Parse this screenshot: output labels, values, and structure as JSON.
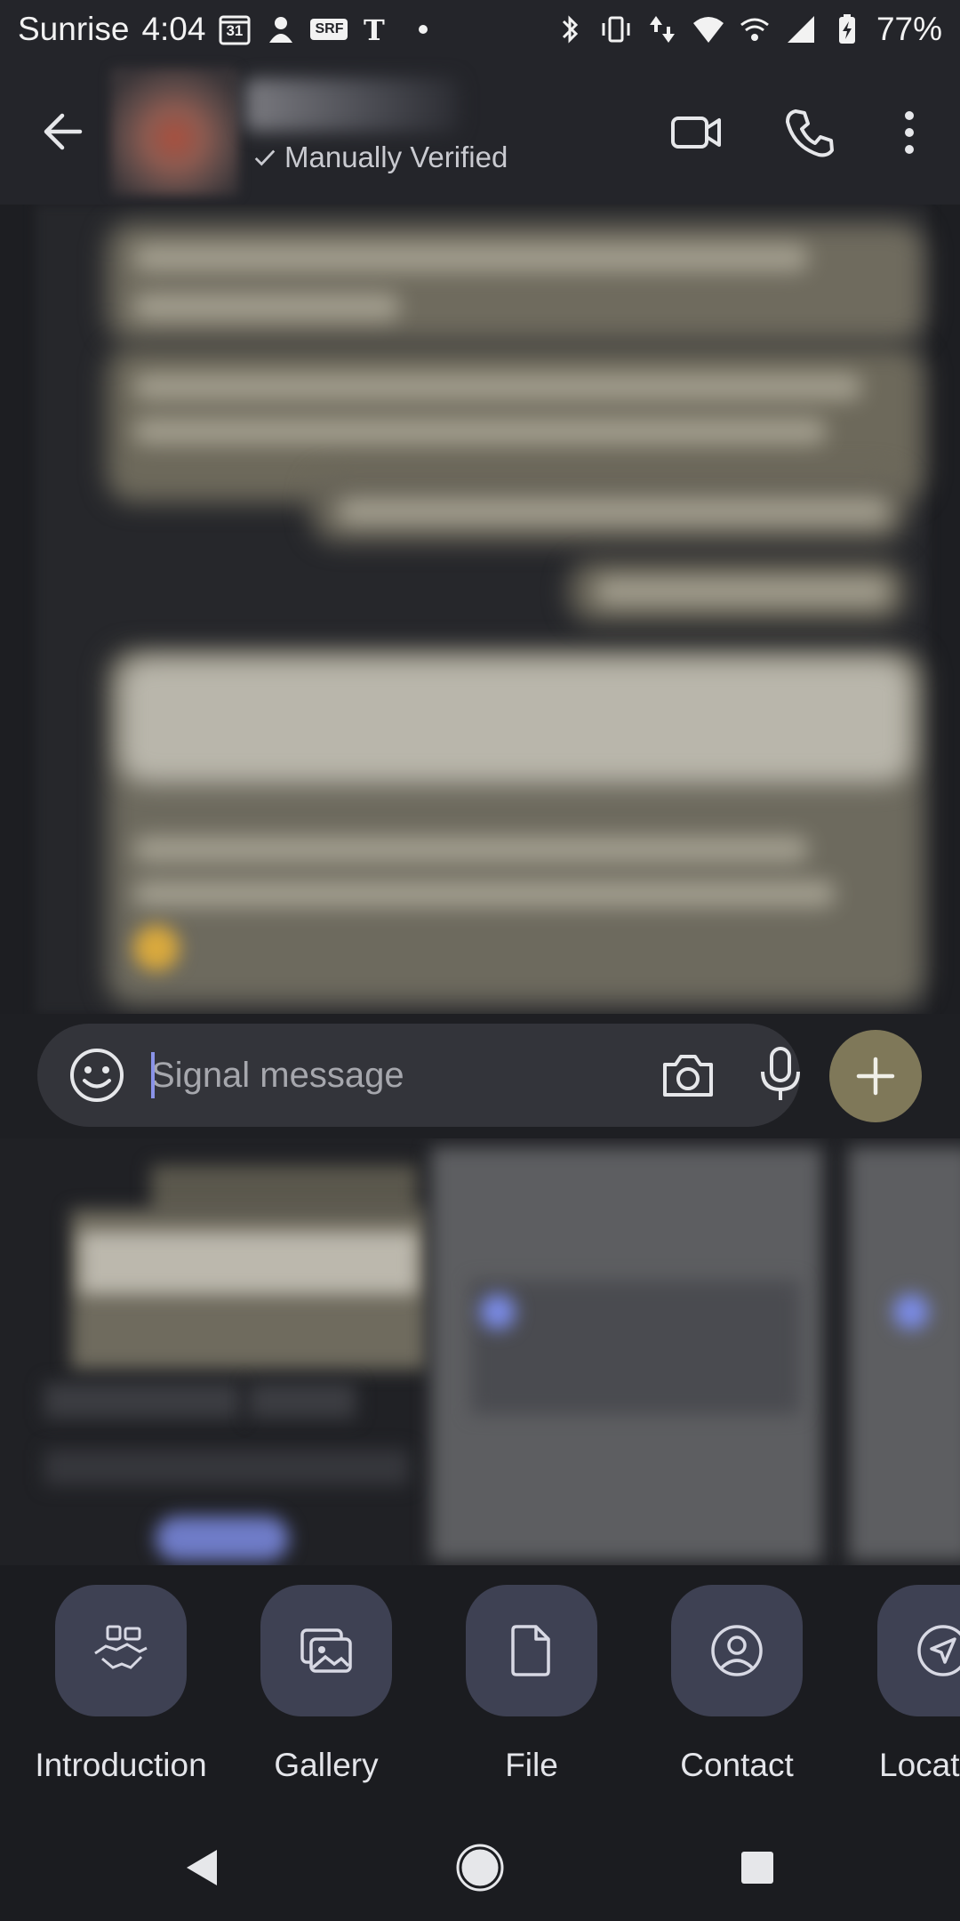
{
  "status_bar": {
    "carrier": "Sunrise",
    "time": "4:04",
    "calendar_day": "31",
    "srf_badge": "SRF",
    "battery": "77%"
  },
  "header": {
    "verified_label": "Manually Verified"
  },
  "composer": {
    "placeholder": "Signal message"
  },
  "attachments": [
    {
      "label": "Introduction",
      "icon": "handshake-icon"
    },
    {
      "label": "Gallery",
      "icon": "gallery-icon"
    },
    {
      "label": "File",
      "icon": "file-icon"
    },
    {
      "label": "Contact",
      "icon": "contact-icon"
    },
    {
      "label": "Locat",
      "icon": "location-icon"
    }
  ],
  "colors": {
    "header_bg": "#24252a",
    "composer_bg": "#33343a",
    "plus_button": "#7f7859",
    "attach_circle": "#3e4153"
  }
}
